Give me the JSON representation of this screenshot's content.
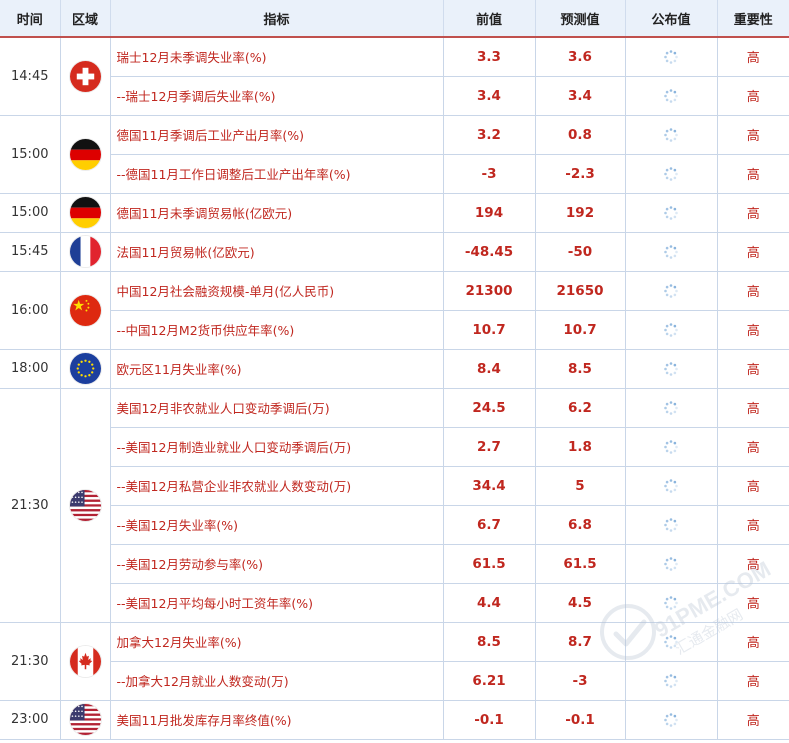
{
  "headers": {
    "time": "时间",
    "region": "区域",
    "indicator": "指标",
    "previous": "前值",
    "forecast": "预测值",
    "actual": "公布值",
    "importance": "重要性"
  },
  "groups": [
    {
      "time": "14:45",
      "flag": "switzerland-flag-icon",
      "rows": [
        {
          "indicator": "瑞士12月未季调失业率(%)",
          "previous": "3.3",
          "forecast": "3.6",
          "importance": "高"
        },
        {
          "indicator": "--瑞士12月季调后失业率(%)",
          "previous": "3.4",
          "forecast": "3.4",
          "importance": "高"
        }
      ]
    },
    {
      "time": "15:00",
      "flag": "germany-flag-icon",
      "rows": [
        {
          "indicator": "德国11月季调后工业产出月率(%)",
          "previous": "3.2",
          "forecast": "0.8",
          "importance": "高"
        },
        {
          "indicator": "--德国11月工作日调整后工业产出年率(%)",
          "previous": "-3",
          "forecast": "-2.3",
          "importance": "高"
        }
      ]
    },
    {
      "time": "15:00",
      "flag": "germany-flag-icon",
      "rows": [
        {
          "indicator": "德国11月未季调贸易帐(亿欧元)",
          "previous": "194",
          "forecast": "192",
          "importance": "高"
        }
      ]
    },
    {
      "time": "15:45",
      "flag": "france-flag-icon",
      "rows": [
        {
          "indicator": "法国11月贸易帐(亿欧元)",
          "previous": "-48.45",
          "forecast": "-50",
          "importance": "高"
        }
      ]
    },
    {
      "time": "16:00",
      "flag": "china-flag-icon",
      "rows": [
        {
          "indicator": "中国12月社会融资规模-单月(亿人民币)",
          "previous": "21300",
          "forecast": "21650",
          "importance": "高"
        },
        {
          "indicator": "--中国12月M2货币供应年率(%)",
          "previous": "10.7",
          "forecast": "10.7",
          "importance": "高"
        }
      ]
    },
    {
      "time": "18:00",
      "flag": "eu-flag-icon",
      "rows": [
        {
          "indicator": "欧元区11月失业率(%)",
          "previous": "8.4",
          "forecast": "8.5",
          "importance": "高"
        }
      ]
    },
    {
      "time": "21:30",
      "flag": "usa-flag-icon",
      "rows": [
        {
          "indicator": "美国12月非农就业人口变动季调后(万)",
          "previous": "24.5",
          "forecast": "6.2",
          "importance": "高"
        },
        {
          "indicator": "--美国12月制造业就业人口变动季调后(万)",
          "previous": "2.7",
          "forecast": "1.8",
          "importance": "高"
        },
        {
          "indicator": "--美国12月私营企业非农就业人数变动(万)",
          "previous": "34.4",
          "forecast": "5",
          "importance": "高"
        },
        {
          "indicator": "--美国12月失业率(%)",
          "previous": "6.7",
          "forecast": "6.8",
          "importance": "高"
        },
        {
          "indicator": "--美国12月劳动参与率(%)",
          "previous": "61.5",
          "forecast": "61.5",
          "importance": "高"
        },
        {
          "indicator": "--美国12月平均每小时工资年率(%)",
          "previous": "4.4",
          "forecast": "4.5",
          "importance": "高"
        }
      ]
    },
    {
      "time": "21:30",
      "flag": "canada-flag-icon",
      "rows": [
        {
          "indicator": "加拿大12月失业率(%)",
          "previous": "8.5",
          "forecast": "8.7",
          "importance": "高"
        },
        {
          "indicator": "--加拿大12月就业人数变动(万)",
          "previous": "6.21",
          "forecast": "-3",
          "importance": "高"
        }
      ]
    },
    {
      "time": "23:00",
      "flag": "usa-flag-icon",
      "rows": [
        {
          "indicator": "美国11月批发库存月率终值(%)",
          "previous": "-0.1",
          "forecast": "-0.1",
          "importance": "高"
        }
      ]
    }
  ],
  "watermark": {
    "brand": "91PME.COM",
    "subtitle": "汇通金融网"
  },
  "colors": {
    "accent": "#c0271f",
    "header_bg": "#eaf1fa",
    "border": "#c9d6e8",
    "header_rule": "#c0504d"
  }
}
